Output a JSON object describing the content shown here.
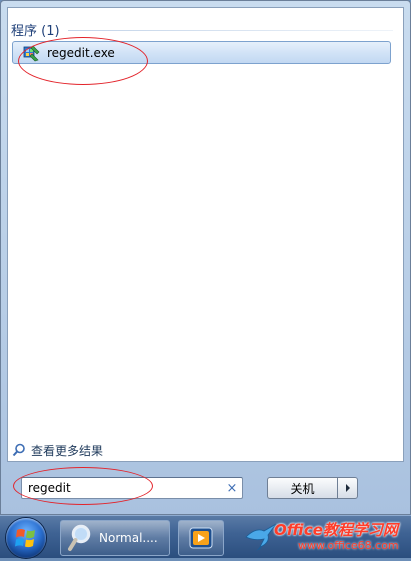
{
  "start_menu": {
    "group_header": "程序 (1)",
    "results": [
      {
        "label": "regedit.exe",
        "icon": "regedit-icon"
      }
    ],
    "see_more_label": "查看更多结果",
    "search": {
      "value": "regedit",
      "clear_glyph": "×"
    },
    "shutdown": {
      "label": "关机"
    }
  },
  "taskbar": {
    "buttons": [
      {
        "label": "Normal....",
        "icon": "magnifier-icon"
      },
      {
        "label": "",
        "icon": "media-player-icon"
      }
    ]
  },
  "watermark": {
    "title": "Office教程学习网",
    "url": "www.office68.com"
  },
  "colors": {
    "highlight_circle": "#e3242b",
    "selected_row": "#cfe0f5",
    "watermark": "#ff3d2a"
  }
}
